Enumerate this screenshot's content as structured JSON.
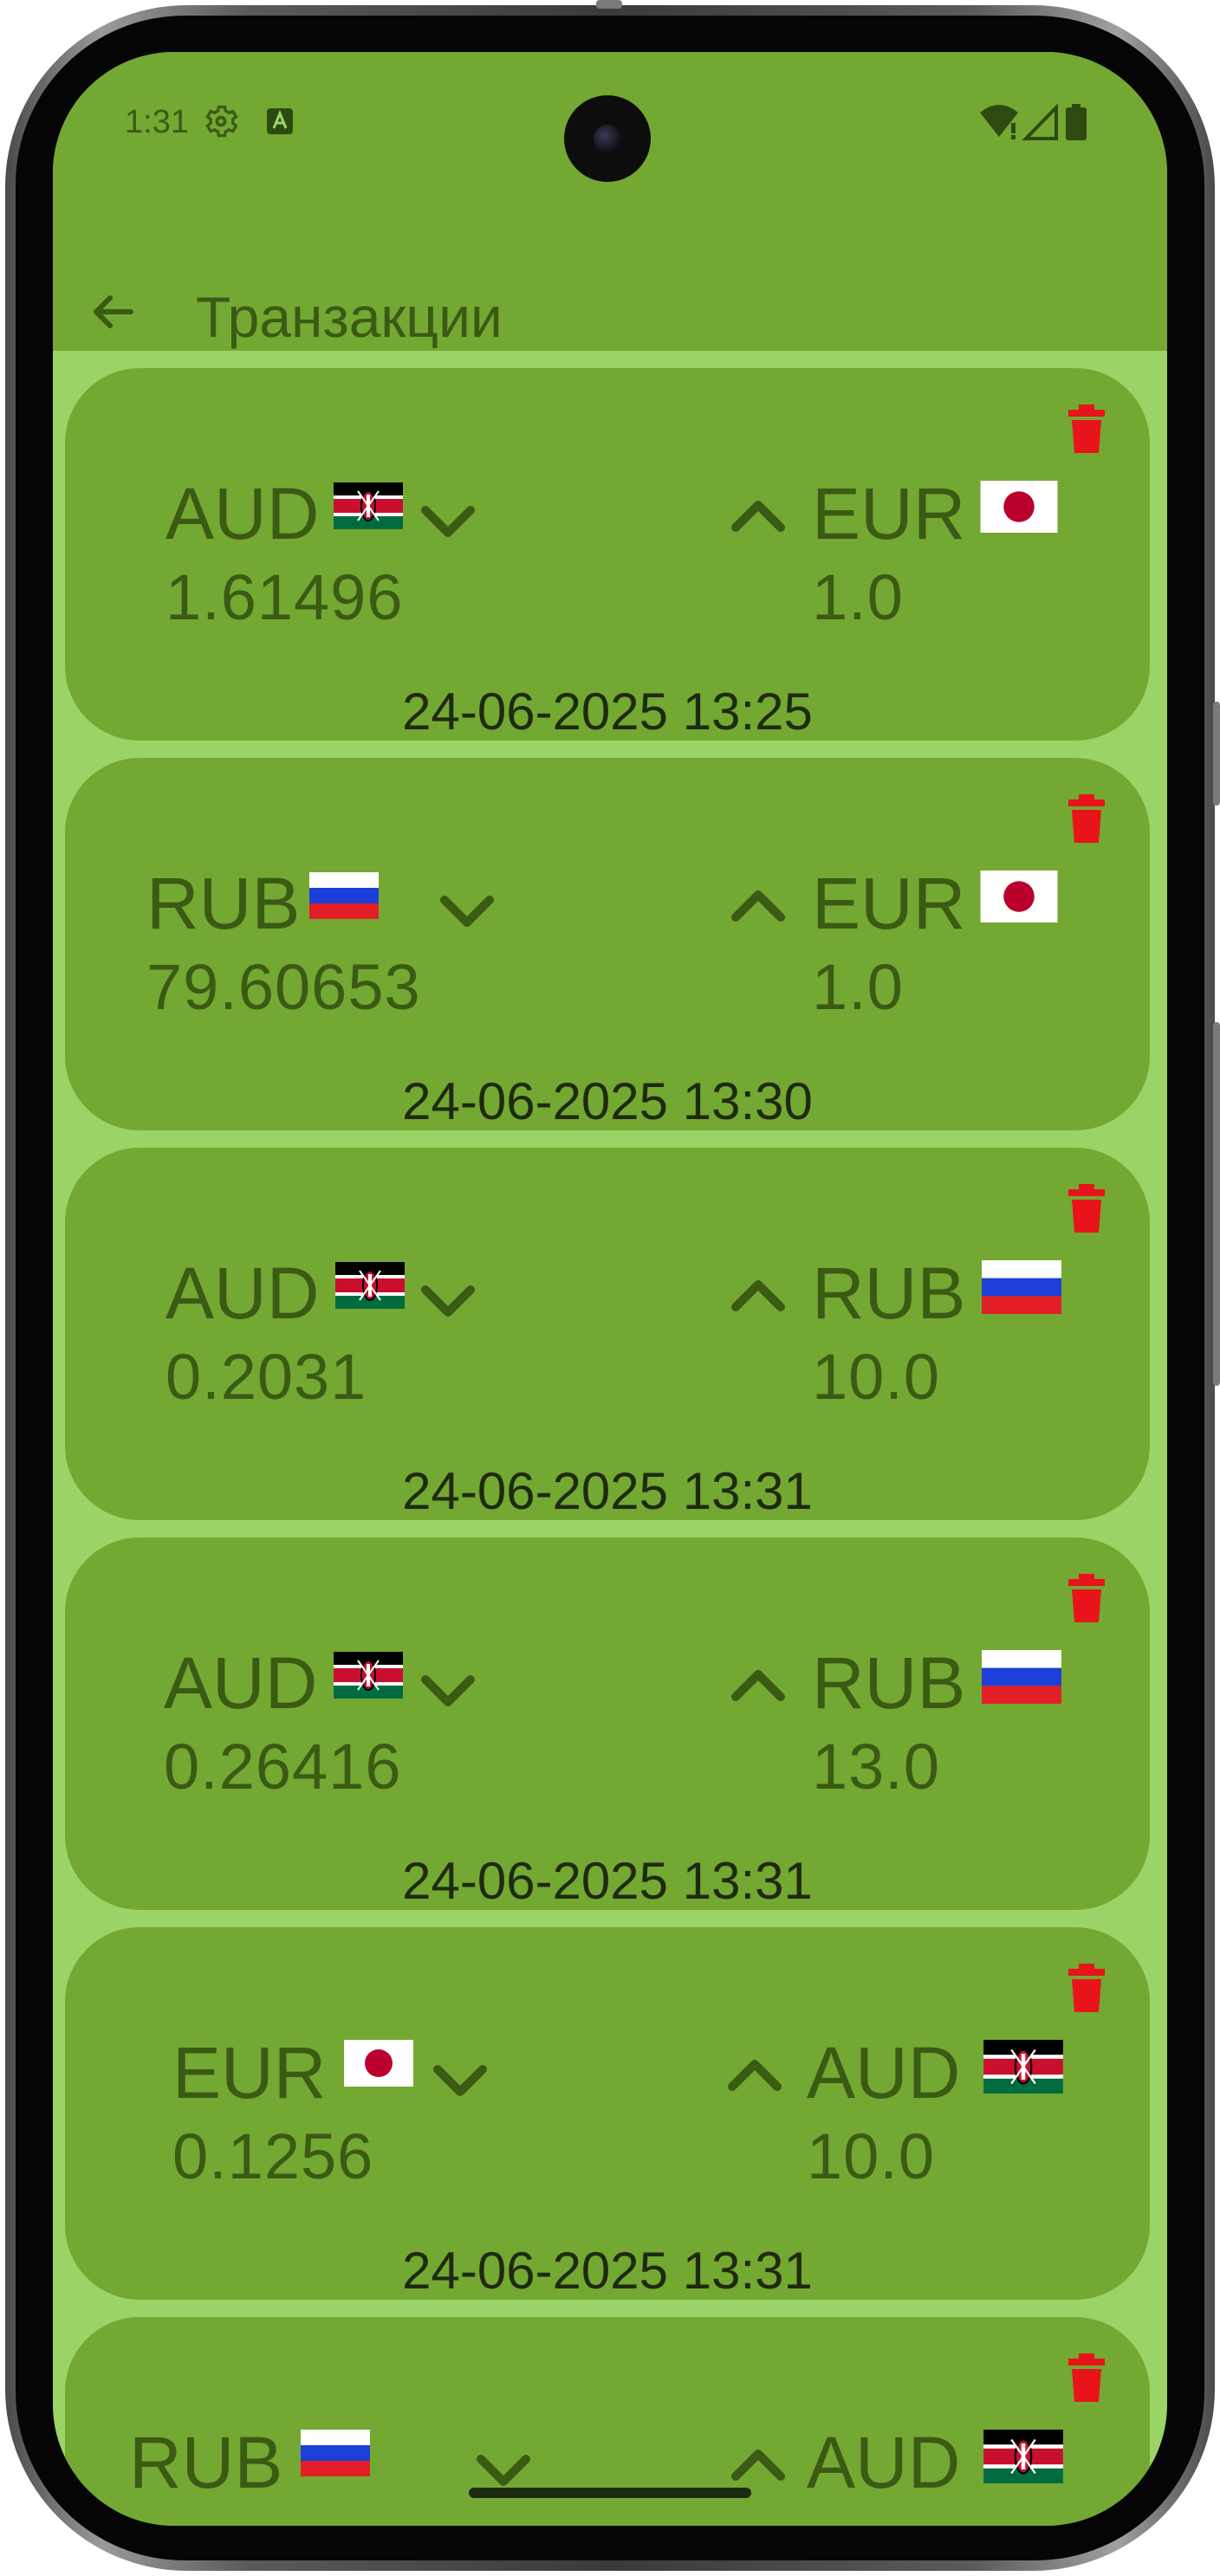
{
  "status_bar": {
    "time": "1:31",
    "icons": [
      "gear-icon",
      "text-a-icon",
      "wifi-icon",
      "signal-icon",
      "battery-icon"
    ]
  },
  "app_bar": {
    "title": "Транзакции",
    "back_icon": "arrow-back-icon"
  },
  "colors": {
    "app_bar": "#73a832",
    "list_background": "#9ad466",
    "card": "#73a832",
    "text": "#3b5a14",
    "date_text": "#1e2a10",
    "delete": "#e8141a"
  },
  "transactions": [
    {
      "from": {
        "code": "AUD",
        "flag": "kenya-flag",
        "amount": "1.61496"
      },
      "to": {
        "code": "EUR",
        "flag": "japan-flag",
        "amount": "1.0"
      },
      "date": "24-06-2025 13:25"
    },
    {
      "from": {
        "code": "RUB",
        "flag": "russia-flag",
        "amount": "79.60653"
      },
      "to": {
        "code": "EUR",
        "flag": "japan-flag",
        "amount": "1.0"
      },
      "date": "24-06-2025 13:30"
    },
    {
      "from": {
        "code": "AUD",
        "flag": "kenya-flag",
        "amount": "0.2031"
      },
      "to": {
        "code": "RUB",
        "flag": "russia-flag",
        "amount": "10.0"
      },
      "date": "24-06-2025 13:31"
    },
    {
      "from": {
        "code": "AUD",
        "flag": "kenya-flag",
        "amount": "0.26416"
      },
      "to": {
        "code": "RUB",
        "flag": "russia-flag",
        "amount": "13.0"
      },
      "date": "24-06-2025 13:31"
    },
    {
      "from": {
        "code": "EUR",
        "flag": "japan-flag",
        "amount": "0.1256"
      },
      "to": {
        "code": "AUD",
        "flag": "kenya-flag",
        "amount": "10.0"
      },
      "date": "24-06-2025 13:31"
    },
    {
      "from": {
        "code": "RUB",
        "flag": "russia-flag",
        "amount": ""
      },
      "to": {
        "code": "AUD",
        "flag": "kenya-flag",
        "amount": ""
      },
      "date": ""
    }
  ]
}
